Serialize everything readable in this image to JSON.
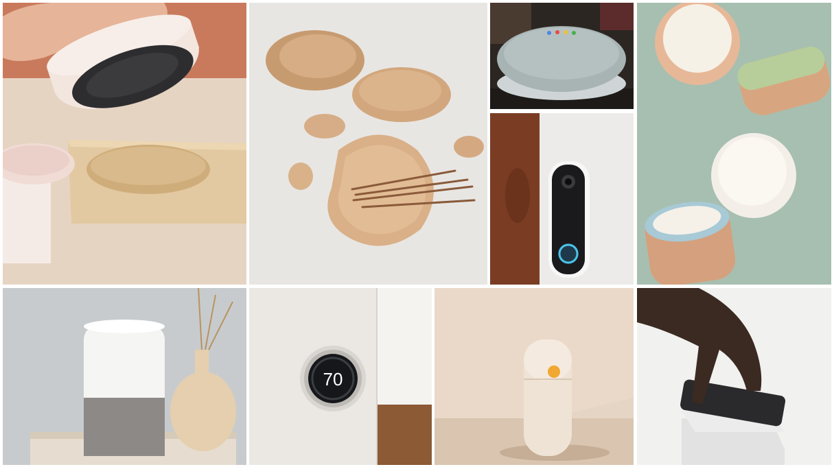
{
  "collage": {
    "tiles": [
      {
        "subject": "speaker-base-on-wooden-tray",
        "bg": "#c97a5c"
      },
      {
        "subject": "wooden-pebbles-and-tray-with-sticks",
        "bg": "#e7e5e2"
      },
      {
        "subject": "mini-smart-speaker",
        "bg": "#2b2622"
      },
      {
        "subject": "video-doorbell",
        "bg": "#ece9e6"
      },
      {
        "subject": "speckled-ceramic-candles",
        "bg": "#a9c0b2"
      },
      {
        "subject": "home-smart-speaker",
        "bg": "#c9ccce"
      },
      {
        "subject": "wall-thermostat",
        "bg": "#ebe8e4"
      },
      {
        "subject": "capsule-device-with-yellow-button",
        "bg": "#e4d5c4"
      },
      {
        "subject": "hand-on-charging-pad",
        "bg": "#f1f1ef"
      }
    ],
    "thermostat_reading": "70"
  }
}
